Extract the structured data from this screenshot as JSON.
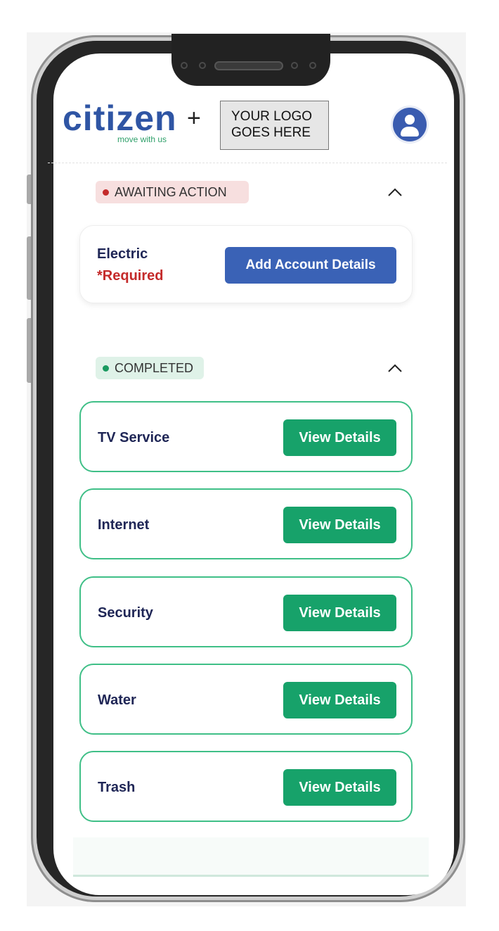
{
  "header": {
    "logo_text": "citizen",
    "logo_tagline": "move with us",
    "plus": "+",
    "logo_placeholder_line1": "YOUR LOGO",
    "logo_placeholder_line2": "GOES HERE"
  },
  "awaiting": {
    "status_label": "AWAITING ACTION",
    "items": [
      {
        "label": "Electric",
        "note": "*Required",
        "button": "Add Account Details"
      }
    ]
  },
  "completed": {
    "status_label": "COMPLETED",
    "items": [
      {
        "label": "TV Service",
        "button": "View Details"
      },
      {
        "label": "Internet",
        "button": "View Details"
      },
      {
        "label": "Security",
        "button": "View Details"
      },
      {
        "label": "Water",
        "button": "View Details"
      },
      {
        "label": "Trash",
        "button": "View Details"
      }
    ]
  },
  "icons": {
    "avatar": "user-avatar-icon",
    "collapse": "chevron-up-icon"
  },
  "colors": {
    "brand_blue": "#2f55a4",
    "brand_green": "#2fa06a",
    "awaiting_red": "#c42a2a",
    "completed_green": "#17a26a",
    "primary_button": "#3a62b6"
  }
}
